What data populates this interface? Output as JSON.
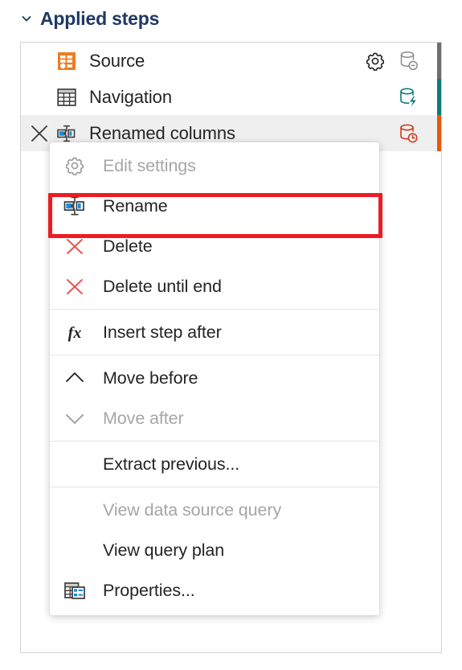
{
  "header": {
    "chevron_icon": "chevron-down-icon",
    "title": "Applied steps"
  },
  "steps": [
    {
      "label": "Source",
      "icon": "source-orange-icon",
      "selected": false,
      "has_delete_x": false,
      "has_gear": true,
      "gear_icon": "gear-icon",
      "right_icon": "database-minus-icon",
      "right_icon_color": "#8a8a8a",
      "edge_bar_color": "#6e6e6e"
    },
    {
      "label": "Navigation",
      "icon": "table-grid-icon",
      "selected": false,
      "has_delete_x": false,
      "has_gear": false,
      "right_icon": "database-bolt-icon",
      "right_icon_color": "#0f7b7b",
      "edge_bar_color": "#0f7b7b"
    },
    {
      "label": "Renamed columns",
      "icon": "rename-icon",
      "selected": true,
      "has_delete_x": true,
      "delete_icon": "close-x-icon",
      "has_gear": false,
      "right_icon": "database-clock-icon",
      "right_icon_color": "#d13b1f",
      "edge_bar_color": "#e8590c"
    }
  ],
  "context_menu": {
    "items": [
      {
        "label": "Edit settings",
        "icon": "gear-icon",
        "disabled": true,
        "indented": false,
        "separator_after": false
      },
      {
        "label": "Rename",
        "icon": "rename-icon",
        "disabled": false,
        "indented": false,
        "separator_after": false,
        "highlighted": true
      },
      {
        "label": "Delete",
        "icon": "red-x-icon",
        "disabled": false,
        "indented": false,
        "separator_after": false
      },
      {
        "label": "Delete until end",
        "icon": "red-x-icon",
        "disabled": false,
        "indented": false,
        "separator_after": true
      },
      {
        "label": "Insert step after",
        "icon": "fx-icon",
        "disabled": false,
        "indented": false,
        "separator_after": true
      },
      {
        "label": "Move before",
        "icon": "chevron-up-icon",
        "disabled": false,
        "indented": false,
        "separator_after": false
      },
      {
        "label": "Move after",
        "icon": "chevron-down-icon",
        "disabled": true,
        "indented": false,
        "separator_after": true
      },
      {
        "label": "Extract previous...",
        "icon": "none",
        "disabled": false,
        "indented": true,
        "separator_after": true
      },
      {
        "label": "View data source query",
        "icon": "none",
        "disabled": true,
        "indented": true,
        "separator_after": false
      },
      {
        "label": "View query plan",
        "icon": "none",
        "disabled": false,
        "indented": true,
        "separator_after": false
      },
      {
        "label": "Properties...",
        "icon": "properties-icon",
        "disabled": false,
        "indented": false,
        "separator_after": false
      }
    ]
  },
  "colors": {
    "highlight_red": "#ed1c24",
    "header_blue": "#1f3864",
    "source_orange": "#ed7d22",
    "delete_red": "#e8534d",
    "selected_row": "#efefef",
    "text": "#242424",
    "disabled_text": "#a6a6a6"
  }
}
